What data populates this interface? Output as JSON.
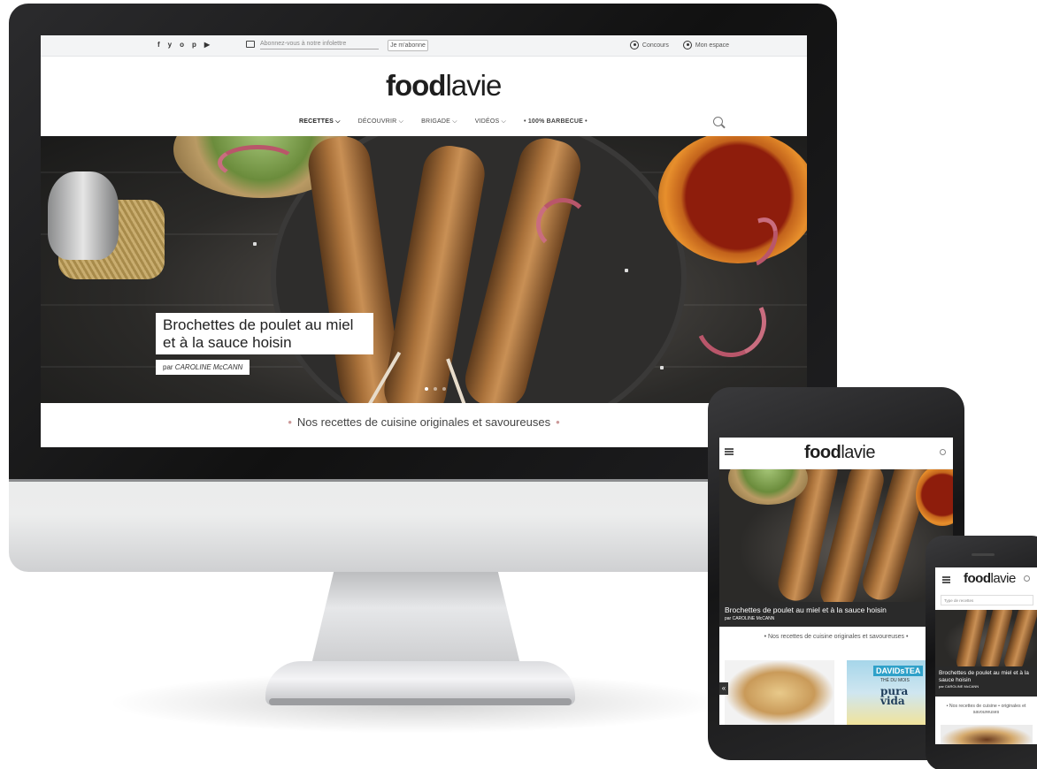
{
  "desktop": {
    "utility": {
      "social_icons": [
        "f",
        "y",
        "o",
        "p",
        "▶"
      ],
      "social_names": [
        "facebook-icon",
        "twitter-icon",
        "instagram-icon",
        "pinterest-icon",
        "youtube-icon"
      ],
      "newsletter_placeholder": "Abonnez-vous à notre infolettre",
      "subscribe_label": "Je m'abonne",
      "contest_label": "Concours",
      "account_label": "Mon espace"
    },
    "logo": {
      "bold": "food",
      "light": "lavie"
    },
    "nav": {
      "items": [
        "RECETTES",
        "DÉCOUVRIR",
        "BRIGADE",
        "VIDÉOS"
      ],
      "bbq_label": "• 100% BARBECUE •",
      "chevron": "⌵"
    },
    "hero": {
      "title": "Brochettes de poulet au miel et à la sauce hoisin",
      "author_prefix": "par",
      "author": "CAROLINE McCANN",
      "slides": 3,
      "active_slide": 1
    },
    "section_title": "Nos recettes de cuisine originales et savoureuses",
    "bullet": "•"
  },
  "tablet": {
    "logo": {
      "bold": "food",
      "light": "lavie"
    },
    "hero_title": "Brochettes de poulet au miel et à la sauce hoisin",
    "author": "par CAROLINE McCANN",
    "section_title": "• Nos recettes de cuisine originales et savoureuses •",
    "card2": {
      "brand": "DAVIDsTEA",
      "sub": "THÉ DU MOIS",
      "text": "pura\nvida"
    },
    "arrow": "«"
  },
  "phone": {
    "logo": {
      "bold": "food",
      "light": "lavie"
    },
    "select_placeholder": "Type de recettes",
    "hero_title": "Brochettes de poulet au miel et à la sauce hoisin",
    "author": "par CAROLINE McCANN",
    "section_title": "• Nos recettes de cuisine • originales et savoureuses"
  }
}
